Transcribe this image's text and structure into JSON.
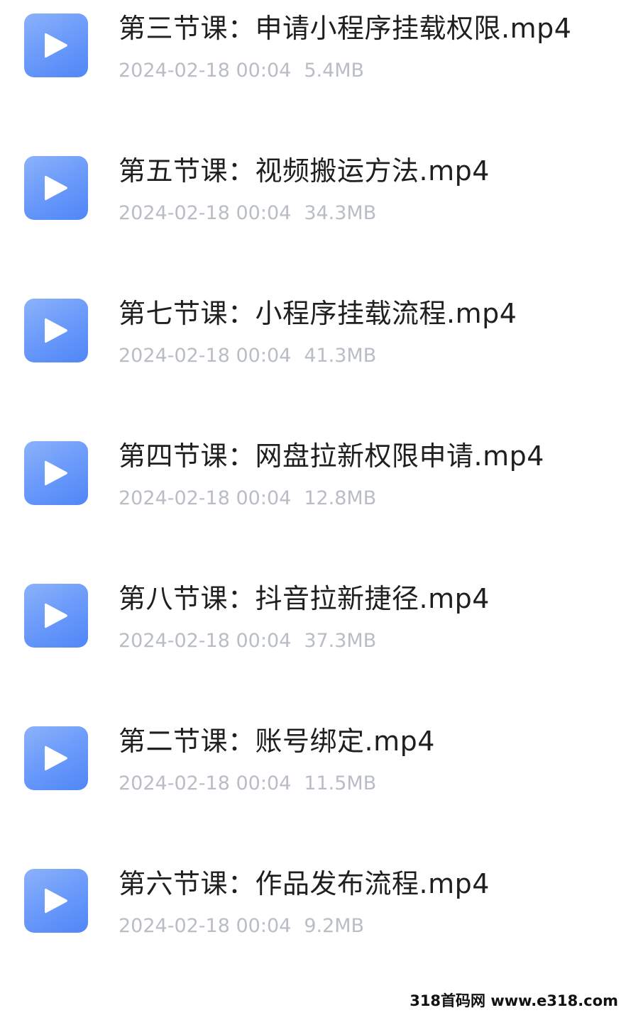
{
  "files": [
    {
      "name": "第三节课：申请小程序挂载权限.mp4",
      "date": "2024-02-18 00:04",
      "size": "5.4MB",
      "icon": "play-icon"
    },
    {
      "name": "第五节课：视频搬运方法.mp4",
      "date": "2024-02-18 00:04",
      "size": "34.3MB",
      "icon": "play-icon"
    },
    {
      "name": "第七节课：小程序挂载流程.mp4",
      "date": "2024-02-18 00:04",
      "size": "41.3MB",
      "icon": "play-icon"
    },
    {
      "name": "第四节课：网盘拉新权限申请.mp4",
      "date": "2024-02-18 00:04",
      "size": "12.8MB",
      "icon": "play-icon"
    },
    {
      "name": "第八节课：抖音拉新捷径.mp4",
      "date": "2024-02-18 00:04",
      "size": "37.3MB",
      "icon": "play-icon"
    },
    {
      "name": "第二节课：账号绑定.mp4",
      "date": "2024-02-18 00:04",
      "size": "11.5MB",
      "icon": "play-icon"
    },
    {
      "name": "第六节课：作品发布流程.mp4",
      "date": "2024-02-18 00:04",
      "size": "9.2MB",
      "icon": "play-icon"
    }
  ],
  "watermark": "318首码网 www.e318.com",
  "colors": {
    "thumb_gradient_start": "#8cb2fb",
    "thumb_gradient_end": "#4f86f7",
    "title_text": "#1f1f1f",
    "meta_text": "#b9bdc6"
  }
}
